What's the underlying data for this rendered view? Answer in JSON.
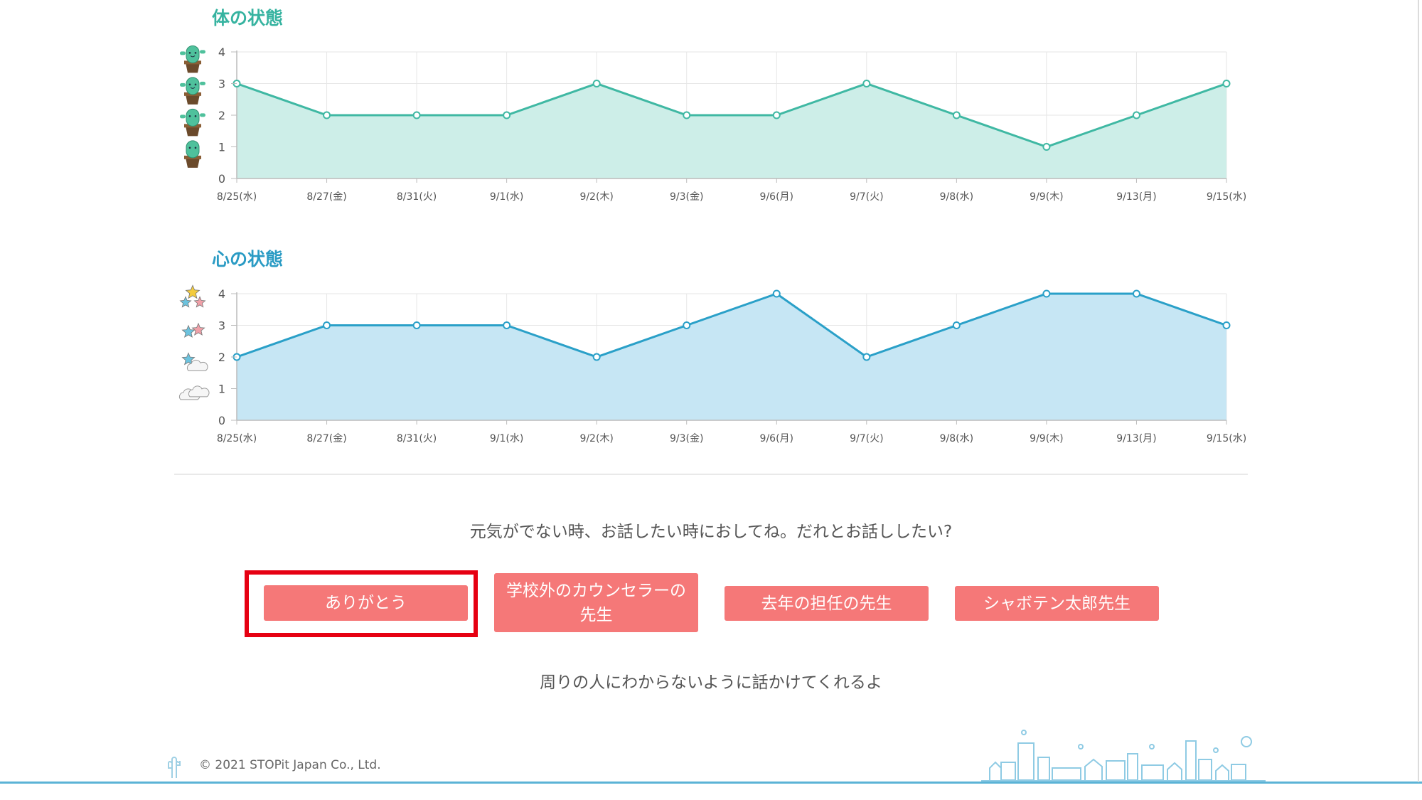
{
  "body_chart": {
    "title": "体の状態",
    "title_color": "#36b3a0",
    "line_color": "#3fb8a3",
    "fill_color": "#cdeee8",
    "chart_data": {
      "type": "area",
      "categories": [
        "8/25(水)",
        "8/27(金)",
        "8/31(火)",
        "9/1(水)",
        "9/2(木)",
        "9/3(金)",
        "9/6(月)",
        "9/7(火)",
        "9/8(水)",
        "9/9(木)",
        "9/13(月)",
        "9/15(水)"
      ],
      "values": [
        3,
        2,
        2,
        2,
        3,
        2,
        2,
        3,
        2,
        1,
        2,
        3
      ],
      "ylim": [
        0,
        4
      ],
      "yticks": [
        "0",
        "1",
        "2",
        "3",
        "4"
      ],
      "grid": true,
      "y_icons": [
        "cactus-happy-icon",
        "cactus-smile-icon",
        "cactus-neutral-icon",
        "cactus-wilted-icon"
      ]
    }
  },
  "mind_chart": {
    "title": "心の状態",
    "title_color": "#2a9bc4",
    "line_color": "#2aa0c8",
    "fill_color": "#c6e6f4",
    "chart_data": {
      "type": "area",
      "categories": [
        "8/25(水)",
        "8/27(金)",
        "8/31(火)",
        "9/1(水)",
        "9/2(木)",
        "9/3(金)",
        "9/6(月)",
        "9/7(火)",
        "9/8(水)",
        "9/9(木)",
        "9/13(月)",
        "9/15(水)"
      ],
      "values": [
        2,
        3,
        3,
        3,
        2,
        3,
        4,
        2,
        3,
        4,
        4,
        3
      ],
      "ylim": [
        0,
        4
      ],
      "yticks": [
        "0",
        "1",
        "2",
        "3",
        "4"
      ],
      "grid": true,
      "y_icons": [
        "three-stars-icon",
        "two-stars-icon",
        "star-cloud-icon",
        "clouds-icon"
      ]
    }
  },
  "prompt_text": "元気がでない時、お話したい時におしてね。だれとお話ししたい?",
  "buttons": [
    {
      "label": "ありがとう"
    },
    {
      "label_line1": "学校外のカウンセラーの",
      "label_line2": "先生"
    },
    {
      "label": "去年の担任の先生"
    },
    {
      "label": "シャボテン太郎先生"
    }
  ],
  "button_color": "#f57878",
  "highlight_color": "#e60012",
  "hint_text": "周りの人にわからないように話かけてくれるよ",
  "footer": {
    "copyright": "© 2021 STOPit Japan Co., Ltd.",
    "logo_icon": "cactus-logo-icon",
    "decoration_icon": "city-skyline-icon"
  }
}
